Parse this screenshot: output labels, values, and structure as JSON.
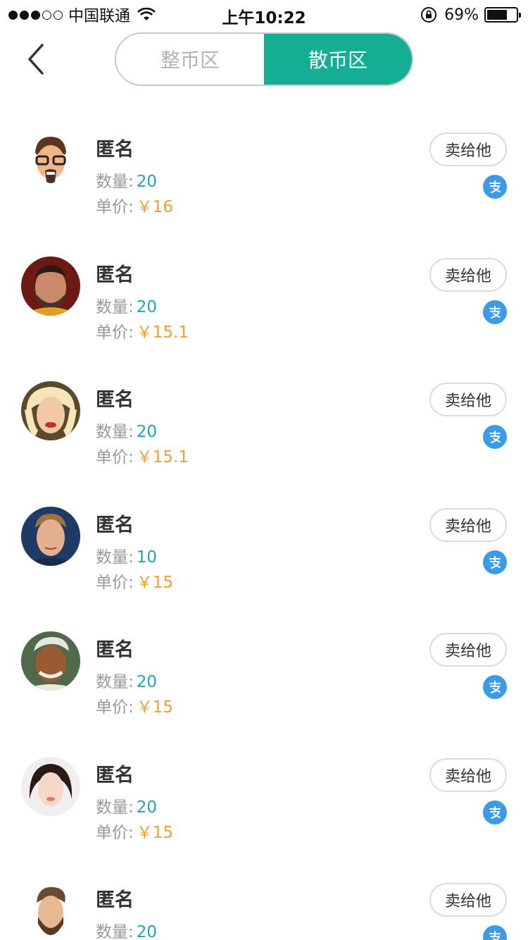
{
  "status_bar": {
    "carrier": "中国联通",
    "time": "上午10:22",
    "battery": "69%",
    "battery_level": 0.69
  },
  "nav": {
    "tabs": [
      {
        "label": "整币区",
        "active": false
      },
      {
        "label": "散币区",
        "active": true
      }
    ]
  },
  "colors": {
    "accent": "#13ae94",
    "quantity": "#1ba8b8",
    "price": "#f0a030",
    "alipay": "#3a9be8"
  },
  "labels": {
    "quantity": "数量:",
    "price": "单价:",
    "sell": "卖给他"
  },
  "listings": [
    {
      "name": "匿名",
      "quantity": "20",
      "price": "￥16",
      "avatar": "cartoon-man-glasses-avatar"
    },
    {
      "name": "匿名",
      "quantity": "20",
      "price": "￥15.1",
      "avatar": "bearded-man-avatar"
    },
    {
      "name": "匿名",
      "quantity": "20",
      "price": "￥15.1",
      "avatar": "blonde-woman-avatar"
    },
    {
      "name": "匿名",
      "quantity": "10",
      "price": "￥15",
      "avatar": "young-man-avatar"
    },
    {
      "name": "匿名",
      "quantity": "20",
      "price": "￥15",
      "avatar": "caricature-old-man-avatar"
    },
    {
      "name": "匿名",
      "quantity": "20",
      "price": "￥15",
      "avatar": "young-woman-avatar"
    },
    {
      "name": "匿名",
      "quantity": "20",
      "price": "",
      "avatar": "cartoon-bearded-man-avatar"
    }
  ]
}
